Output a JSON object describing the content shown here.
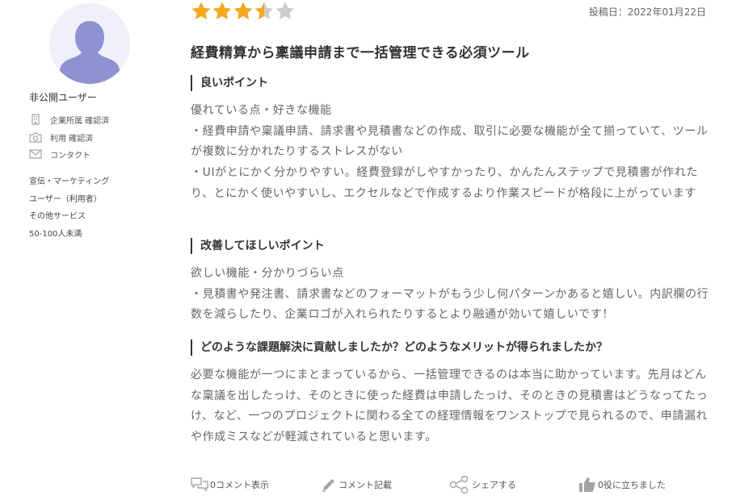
{
  "reviewer": {
    "name": "非公開ユーザー",
    "verifications": [
      {
        "label": "企業所属 確認済",
        "icon": "building-icon"
      },
      {
        "label": "利用 確認済",
        "icon": "camera-icon"
      },
      {
        "label": "コンタクト",
        "icon": "envelope-icon"
      }
    ],
    "attributes": [
      "宣伝・マーケティング",
      "ユーザー（利用者）",
      "その他サービス",
      "50-100人未満"
    ]
  },
  "review": {
    "rating": 3.5,
    "max_rating": 5,
    "post_date": "投稿日：2022年01月22日",
    "title": "経費精算から稟議申請まで一括管理できる必須ツール",
    "sections": [
      {
        "heading": "良いポイント",
        "body": "優れている点・好きな機能\n・経費申請や稟議申請、請求書や見積書などの作成、取引に必要な機能が全て揃っていて、ツールが複数に分かれたりするストレスがない\n・UIがとにかく分かりやすい。経費登録がしやすかったり、かんたんステップで見積書が作れたり、とにかく使いやすいし、エクセルなどで作成するより作業スピードが格段に上がっています"
      },
      {
        "heading": "改善してほしいポイント",
        "body": "欲しい機能・分かりづらい点\n・見積書や発注書、請求書などのフォーマットがもう少し何パターンかあると嬉しい。内訳欄の行数を減らしたり、企業ロゴが入れられたりするとより融通が効いて嬉しいです！"
      },
      {
        "heading": "どのような課題解決に貢献しましたか？どのようなメリットが得られましたか？",
        "body": "必要な機能が一つにまとまっているから、一括管理できるのは本当に助かっています。先月はどんな稟議を出したっけ、そのときに使った経費は申請したっけ、そのときの見積書はどうなってたっけ、など、一つのプロジェクトに関わる全ての経理情報をワンストップで見られるので、申請漏れや作成ミスなどが軽減されていると思います。"
      }
    ]
  },
  "actions": {
    "comments": "0コメント表示",
    "write_comment": "コメント記載",
    "share": "シェアする",
    "helpful": "0役に立ちました"
  },
  "colors": {
    "star_filled": "#f4a91f",
    "star_empty": "#cccccc",
    "avatar_bg": "#f0f1f8",
    "avatar_figure": "#8e92d3",
    "icon_gray": "#a3a3a3"
  }
}
